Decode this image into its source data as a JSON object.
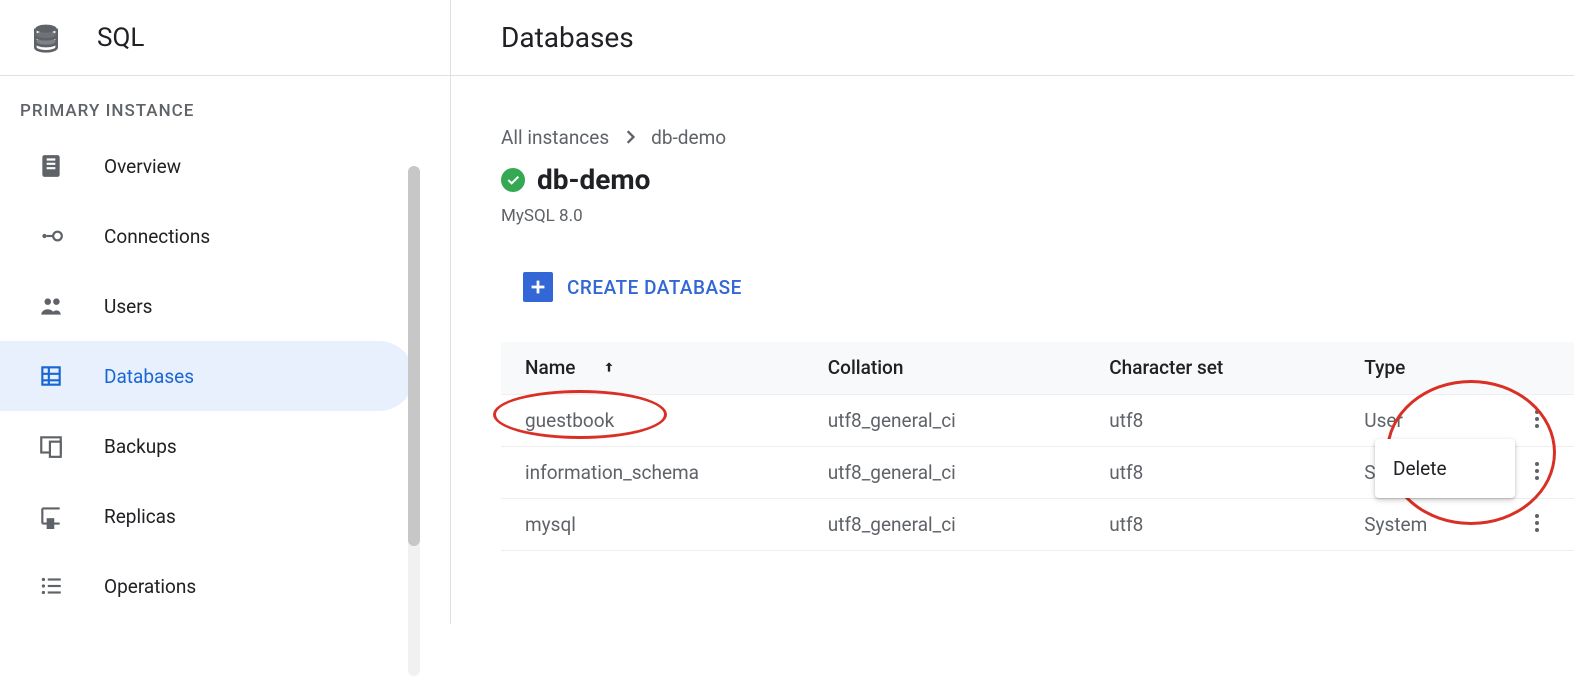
{
  "product": {
    "title": "SQL"
  },
  "sidebar": {
    "heading": "PRIMARY INSTANCE",
    "items": [
      {
        "label": "Overview",
        "icon": "overview-icon",
        "active": false
      },
      {
        "label": "Connections",
        "icon": "connections-icon",
        "active": false
      },
      {
        "label": "Users",
        "icon": "users-icon",
        "active": false
      },
      {
        "label": "Databases",
        "icon": "databases-icon",
        "active": true
      },
      {
        "label": "Backups",
        "icon": "backups-icon",
        "active": false
      },
      {
        "label": "Replicas",
        "icon": "replicas-icon",
        "active": false
      },
      {
        "label": "Operations",
        "icon": "operations-icon",
        "active": false
      }
    ]
  },
  "main": {
    "section_title": "Databases",
    "breadcrumb": {
      "root": "All instances",
      "leaf": "db-demo"
    },
    "instance": {
      "name": "db-demo",
      "engine": "MySQL 8.0"
    },
    "create_label": "CREATE DATABASE",
    "table": {
      "columns": [
        "Name",
        "Collation",
        "Character set",
        "Type"
      ],
      "sort_column": "Name",
      "sort_dir": "asc",
      "rows": [
        {
          "name": "guestbook",
          "collation": "utf8_general_ci",
          "charset": "utf8",
          "type": "User"
        },
        {
          "name": "information_schema",
          "collation": "utf8_general_ci",
          "charset": "utf8",
          "type": "System"
        },
        {
          "name": "mysql",
          "collation": "utf8_general_ci",
          "charset": "utf8",
          "type": "System"
        }
      ]
    },
    "row_menu": {
      "options": [
        "Delete"
      ],
      "open_on_row": 0
    }
  },
  "annotations": {
    "name_highlight": "guestbook",
    "action_highlight": "row-0-kebab-and-delete"
  }
}
